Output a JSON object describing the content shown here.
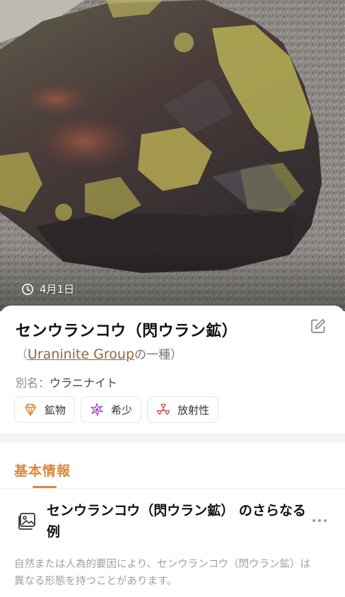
{
  "hero": {
    "photo_subject": "uraninite-specimen-photo",
    "date_label": "4月1日",
    "date_icon": "clock-icon"
  },
  "header": {
    "title": "センウランコウ（閃ウラン鉱）",
    "edit_icon": "edit-icon",
    "group_open": "（",
    "group_link": "Uraninite Group",
    "group_suffix": "の一種）",
    "alias_label": "別名：",
    "alias_value": "ウラニナイト"
  },
  "tags": [
    {
      "icon": "mineral-icon",
      "label": "鉱物",
      "color": "#e0863c"
    },
    {
      "icon": "sparkle-icon",
      "label": "希少",
      "color": "#a24bc0"
    },
    {
      "icon": "radiation-icon",
      "label": "放射性",
      "color": "#d9534f"
    }
  ],
  "info": {
    "section_title": "基本情報",
    "example_icon": "image-gallery-icon",
    "example_title": "センウランコウ（閃ウラン鉱） のさらなる例",
    "more_icon": "more-dots-icon",
    "example_desc": "自然または人為的要因により、センウランコウ（閃ウラン鉱）は異なる形態を持つことがあります。"
  },
  "colors": {
    "accent": "#e0863c",
    "link": "#8a6a3e"
  }
}
